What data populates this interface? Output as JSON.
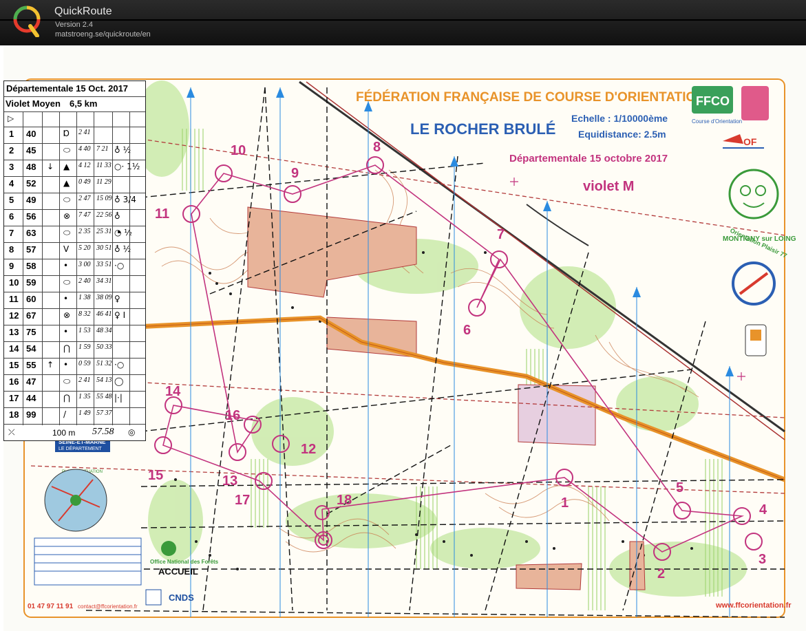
{
  "app": {
    "name": "QuickRoute",
    "version": "Version 2.4",
    "url": "matstroeng.se/quickroute/en"
  },
  "map": {
    "federation": "FÉDÉRATION FRANÇAISE DE COURSE D'ORIENTATION",
    "area_name": "LE ROCHER BRULÉ",
    "scale": "Echelle : 1/10000ème",
    "equidistance": "Equidistance: 2.5m",
    "event": "Départementale 15 octobre 2017",
    "course": "violet M",
    "ffco_logo": "FFCO",
    "ffco_sub": "Course d'Orientation",
    "club_1": "Orientation Plaisir 77",
    "club_2": "MONTIGNY sur LOING",
    "department": "SEINE-ET-MARNE",
    "department_sub": "LE DÉPARTEMENT",
    "plan_label": "PLAN DE SITUATION",
    "onf": "Office National des Forêts",
    "accueil": "ACCUEIL",
    "cnds": "CNDS",
    "phone": "01 47 97 11 91",
    "contact": "contact@ffcorientation.fr",
    "website": "www.ffcorientation.fr",
    "colors": {
      "course": "#c2337e",
      "road": "#e8932a",
      "fence": "#b23a3a",
      "contour": "#c9794c",
      "vegetation": "#9fd470",
      "north": "#2b8be0"
    }
  },
  "controls": {
    "labels": [
      "1",
      "2",
      "3",
      "4",
      "5",
      "6",
      "7",
      "8",
      "9",
      "10",
      "11",
      "12",
      "13",
      "14",
      "15",
      "16",
      "17",
      "18"
    ]
  },
  "description_sheet": {
    "title": "Départementale 15 Oct. 2017",
    "course": "Violet Moyen",
    "distance": "6,5 km",
    "start_symbol": "▷",
    "rows": [
      {
        "n": "1",
        "code": "40",
        "dir": "",
        "feature": "Ɒ",
        "split": "2 41",
        "t2": "",
        "extra": ""
      },
      {
        "n": "2",
        "code": "45",
        "dir": "",
        "feature": "⬭",
        "split": "4 40",
        "t2": "7 21",
        "extra": "♁ ½"
      },
      {
        "n": "3",
        "code": "48",
        "dir": "↓",
        "feature": "▲",
        "split": "4 12",
        "t2": "11 33",
        "extra": "○· 1½"
      },
      {
        "n": "4",
        "code": "52",
        "dir": "",
        "feature": "▲",
        "split": "0 49",
        "t2": "11 29",
        "extra": ""
      },
      {
        "n": "5",
        "code": "49",
        "dir": "",
        "feature": "⬭",
        "split": "2 47",
        "t2": "15 09",
        "extra": "♁ 3/4"
      },
      {
        "n": "6",
        "code": "56",
        "dir": "",
        "feature": "⊗",
        "split": "7 47",
        "t2": "22 56",
        "extra": "♁"
      },
      {
        "n": "7",
        "code": "63",
        "dir": "",
        "feature": "⬭",
        "split": "2 35",
        "t2": "25 31",
        "extra": "◔ ½"
      },
      {
        "n": "8",
        "code": "57",
        "dir": "",
        "feature": "V",
        "split": "5 20",
        "t2": "30 51",
        "extra": "♁ ½"
      },
      {
        "n": "9",
        "code": "58",
        "dir": "",
        "feature": "•",
        "split": "3 00",
        "t2": "33 51",
        "extra": "·○"
      },
      {
        "n": "10",
        "code": "59",
        "dir": "",
        "feature": "⬭",
        "split": "2 40",
        "t2": "34 31",
        "extra": ""
      },
      {
        "n": "11",
        "code": "60",
        "dir": "",
        "feature": "•",
        "split": "1 38",
        "t2": "38 09",
        "extra": "♀"
      },
      {
        "n": "12",
        "code": "67",
        "dir": "",
        "feature": "⊗",
        "split": "8 32",
        "t2": "46 41",
        "extra": "♀ I"
      },
      {
        "n": "13",
        "code": "75",
        "dir": "",
        "feature": "•",
        "split": "1 53",
        "t2": "48 34",
        "extra": ""
      },
      {
        "n": "14",
        "code": "54",
        "dir": "",
        "feature": "⋂",
        "split": "1 59",
        "t2": "50 33",
        "extra": ""
      },
      {
        "n": "15",
        "code": "55",
        "dir": "↑",
        "feature": "•",
        "split": "0 59",
        "t2": "51 32",
        "extra": "·○"
      },
      {
        "n": "16",
        "code": "47",
        "dir": "",
        "feature": "⬭",
        "split": "2 41",
        "t2": "54 13",
        "extra": "◯"
      },
      {
        "n": "17",
        "code": "44",
        "dir": "",
        "feature": "⋂",
        "split": "1 35",
        "t2": "55 48",
        "extra": "|·|"
      },
      {
        "n": "18",
        "code": "99",
        "dir": "",
        "feature": "/",
        "split": "1 49",
        "t2": "57 37",
        "extra": ""
      }
    ],
    "finish_distance": "100 m",
    "finish_time": "57.58"
  }
}
